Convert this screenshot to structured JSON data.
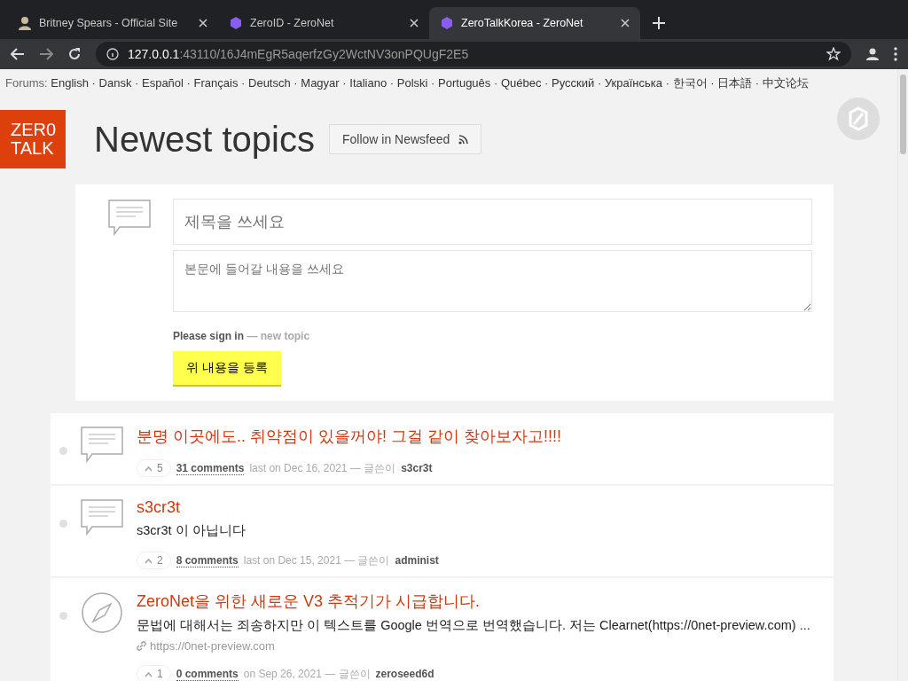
{
  "browser": {
    "tabs": [
      {
        "title": "Britney Spears - Official Site",
        "selected": false
      },
      {
        "title": "ZeroID - ZeroNet",
        "selected": false
      },
      {
        "title": "ZeroTalkKorea - ZeroNet",
        "selected": true
      }
    ],
    "url_host": "127.0.0.1",
    "url_rest": ":43110/16J4mEgR5aqerfzGy2WctNV3onPQUgF2E5"
  },
  "forums": {
    "label": "Forums:",
    "separator": "·",
    "languages": [
      "English",
      "Dansk",
      "Español",
      "Français",
      "Deutsch",
      "Magyar",
      "Italiano",
      "Polski",
      "Português",
      "Québec",
      "Русский",
      "Українська",
      "한국어",
      "日本語",
      "中文论坛"
    ]
  },
  "logo": {
    "line1": "ZER0",
    "line2": "TALK"
  },
  "header": {
    "title": "Newest topics",
    "follow_button": "Follow in Newsfeed"
  },
  "new_topic": {
    "title_placeholder": "제목을 쓰세요",
    "body_placeholder": "본문에 들어갈 내용을 쓰세요",
    "sign_in": "Please sign in",
    "sign_in_suffix": "— new topic",
    "submit": "위 내용을 등록"
  },
  "topics": [
    {
      "kind": "text",
      "title": "분명 이곳에도.. 취약점이 있을꺼야! 그걸 같이 찾아보자고!!!!",
      "votes": "5",
      "comments": "31 comments",
      "date_prefix": "last on",
      "date": "Dec 16, 2021",
      "author_label": "— 글쓴이",
      "author": "s3cr3t"
    },
    {
      "kind": "text",
      "title": "s3cr3t",
      "body": "s3cr3t 이 아닙니다",
      "votes": "2",
      "comments": "8 comments",
      "date_prefix": "last on",
      "date": "Dec 15, 2021",
      "author_label": "— 글쓴이",
      "author": "administ"
    },
    {
      "kind": "link",
      "title": "ZeroNet을 위한 새로운 V3 추적기가 시급합니다.",
      "body": "문법에 대해서는 죄송하지만 이 텍스트를 Google 번역으로 번역했습니다. 저는 Clearnet(https://0net-preview.com) ...",
      "link": "https://0net-preview.com",
      "votes": "1",
      "comments": "0 comments",
      "date_prefix": "on",
      "date": "Sep 26, 2021",
      "author_label": "— 글쓴이",
      "author": "zeroseed6d"
    }
  ]
}
